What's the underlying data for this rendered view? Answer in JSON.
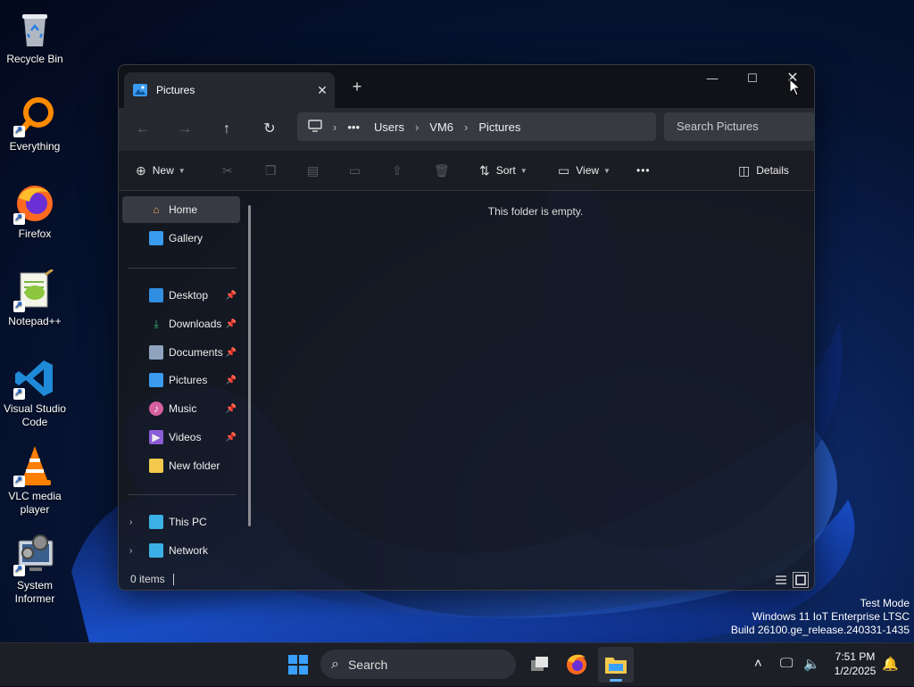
{
  "desktop": {
    "icons": [
      {
        "label": "Recycle Bin"
      },
      {
        "label": "Everything"
      },
      {
        "label": "Firefox"
      },
      {
        "label": "Notepad++"
      },
      {
        "label": "Visual Studio Code"
      },
      {
        "label": "VLC media player"
      },
      {
        "label": "System Informer"
      }
    ]
  },
  "window": {
    "tab_title": "Pictures",
    "new_tab": "+",
    "breadcrumb": [
      "Users",
      "VM6",
      "Pictures"
    ],
    "search_placeholder": "Search Pictures",
    "toolbar": {
      "new_label": "New",
      "sort_label": "Sort",
      "view_label": "View",
      "more_label": "•••",
      "details_label": "Details"
    },
    "sidebar": {
      "top": [
        {
          "label": "Home",
          "selected": true
        },
        {
          "label": "Gallery"
        }
      ],
      "quick_access": [
        {
          "label": "Desktop",
          "pinned": true
        },
        {
          "label": "Downloads",
          "pinned": true
        },
        {
          "label": "Documents",
          "pinned": true
        },
        {
          "label": "Pictures",
          "pinned": true
        },
        {
          "label": "Music",
          "pinned": true
        },
        {
          "label": "Videos",
          "pinned": true
        },
        {
          "label": "New folder",
          "pinned": false
        }
      ],
      "bottom": [
        {
          "label": "This PC"
        },
        {
          "label": "Network"
        }
      ]
    },
    "empty_message": "This folder is empty.",
    "status": {
      "item_count": "0 items"
    }
  },
  "watermark": {
    "line1": "Test Mode",
    "line2": "Windows 11 IoT Enterprise LTSC",
    "line3": "Build 26100.ge_release.240331-1435"
  },
  "taskbar": {
    "search_label": "Search",
    "time": "7:51 PM",
    "date": "1/2/2025"
  },
  "colors": {
    "accent": "#1a73e8",
    "folder": "#f2c94c",
    "window_bg": "#16181e"
  }
}
